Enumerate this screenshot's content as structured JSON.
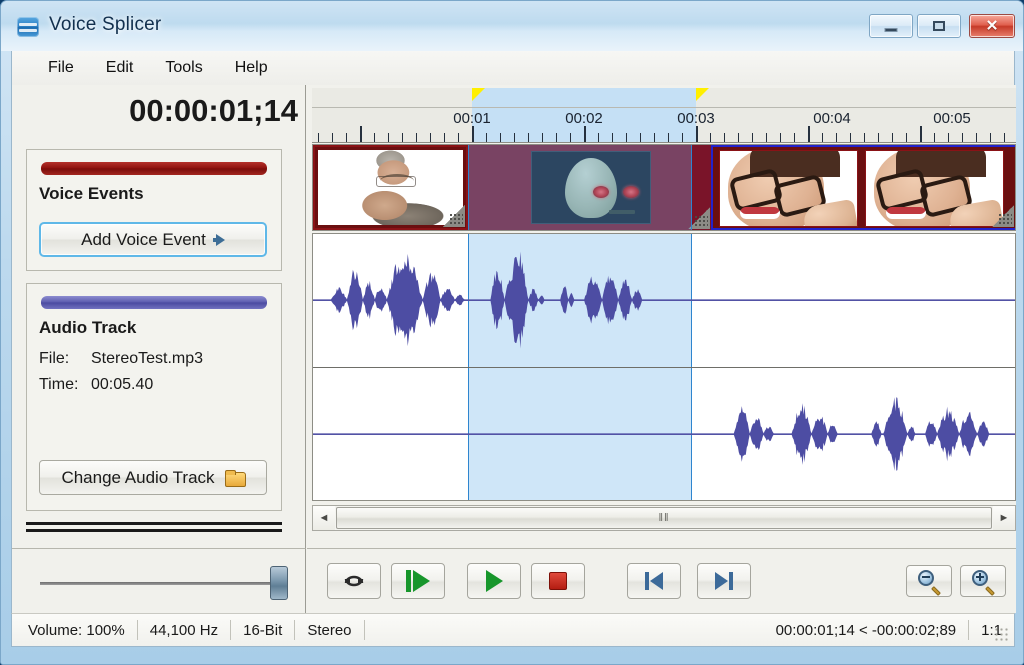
{
  "window": {
    "title": "Voice Splicer",
    "icon": "app-icon",
    "buttons": {
      "minimize": "minimize-button",
      "maximize": "maximize-button",
      "close_glyph": "✕"
    }
  },
  "menu": {
    "items": [
      {
        "label": "File"
      },
      {
        "label": "Edit"
      },
      {
        "label": "Tools"
      },
      {
        "label": "Help"
      }
    ]
  },
  "left_panel": {
    "timecode": "00:00:01;14",
    "voice_events": {
      "title": "Voice Events",
      "accent_color": "#8e110e",
      "add_button": "Add Voice Event",
      "add_button_icon": "arrow-right-icon"
    },
    "audio_track": {
      "title": "Audio Track",
      "accent_color": "#5c5caf",
      "file_label": "File:",
      "file_value": "StereoTest.mp3",
      "time_label": "Time:",
      "time_value": "00:05.40",
      "change_button": "Change Audio Track",
      "change_button_icon": "folder-open-icon"
    }
  },
  "volume_slider": {
    "name": "volume-slider",
    "value_percent": 100
  },
  "timeline": {
    "ruler_labels": [
      "00:01",
      "00:02",
      "00:03",
      "00:04",
      "00:05"
    ],
    "selection_start_label": "00:01",
    "selection_end_label": "00:03",
    "marker_icon": "selection-marker-icon",
    "video_clips": [
      {
        "name": "clip-man",
        "label": ""
      },
      {
        "name": "clip-alien",
        "label": ""
      },
      {
        "name": "clip-woman-pair",
        "label": ""
      }
    ],
    "scrollbar": {
      "left_arrow": "◄",
      "right_arrow": "►",
      "grip": "‖‖"
    }
  },
  "transport": {
    "buttons": [
      {
        "name": "loop-button",
        "icon": "loop-icon"
      },
      {
        "name": "play-from-start-button",
        "icon": "play-from-start-icon"
      },
      {
        "name": "play-button",
        "icon": "play-icon"
      },
      {
        "name": "stop-button",
        "icon": "stop-icon"
      },
      {
        "name": "skip-to-start-button",
        "icon": "skip-back-icon"
      },
      {
        "name": "skip-to-end-button",
        "icon": "skip-forward-icon"
      },
      {
        "name": "zoom-out-button",
        "icon": "magnifier-minus-icon"
      },
      {
        "name": "zoom-in-button",
        "icon": "magnifier-plus-icon"
      }
    ]
  },
  "statusbar": {
    "volume": "Volume: 100%",
    "sample_rate": "44,100 Hz",
    "bit_depth": "16-Bit",
    "channels": "Stereo",
    "selection_range": "00:00:01;14 < -00:00:02;89",
    "ratio": "1:1"
  }
}
